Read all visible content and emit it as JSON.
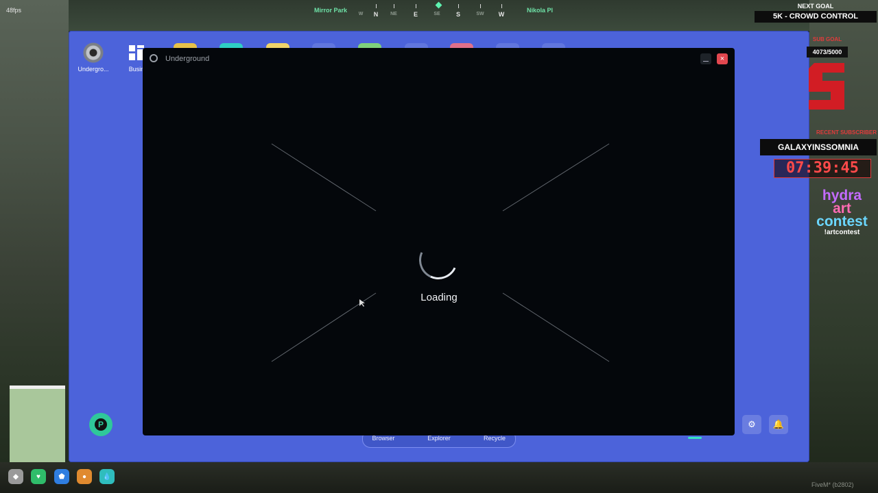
{
  "hud": {
    "fps": "48fps",
    "compass": {
      "street_left": "Mirror Park",
      "street_right": "Nikola Pl",
      "directions": [
        "W",
        "N",
        "NE",
        "E",
        "SE",
        "S",
        "SW",
        "W"
      ]
    }
  },
  "desktop": {
    "icons": [
      {
        "label": "Undergro...",
        "icon": "turbo-icon"
      },
      {
        "label": "Busin",
        "icon": "grid-icon"
      }
    ],
    "taskbar": [
      "Browser",
      "Explorer",
      "Recycle"
    ],
    "system_buttons": [
      "settings-icon",
      "bell-icon"
    ]
  },
  "window": {
    "title": "Underground",
    "status": "Loading"
  },
  "stream_overlay": {
    "next_goal_label": "NEXT GOAL",
    "next_goal": "5K - CROWD CONTROL",
    "sub_goal_label": "SUB GOAL",
    "sub_goal_progress": "4073/5000",
    "recent_subscriber_label": "RECENT SUBSCRIBER",
    "recent_subscriber": "GALAXYINSSOMNIA",
    "timer": "07:39:45",
    "contest_words": [
      "hydra",
      "art",
      "contest"
    ],
    "contest_command": "!artcontest"
  },
  "footer": {
    "fivem": "FiveM* (b2802)"
  },
  "colors": {
    "desktop_blue": "#4c63da",
    "accent_green": "#2fc89a",
    "close_red": "#e2474f",
    "overlay_red": "#e23b3b"
  }
}
